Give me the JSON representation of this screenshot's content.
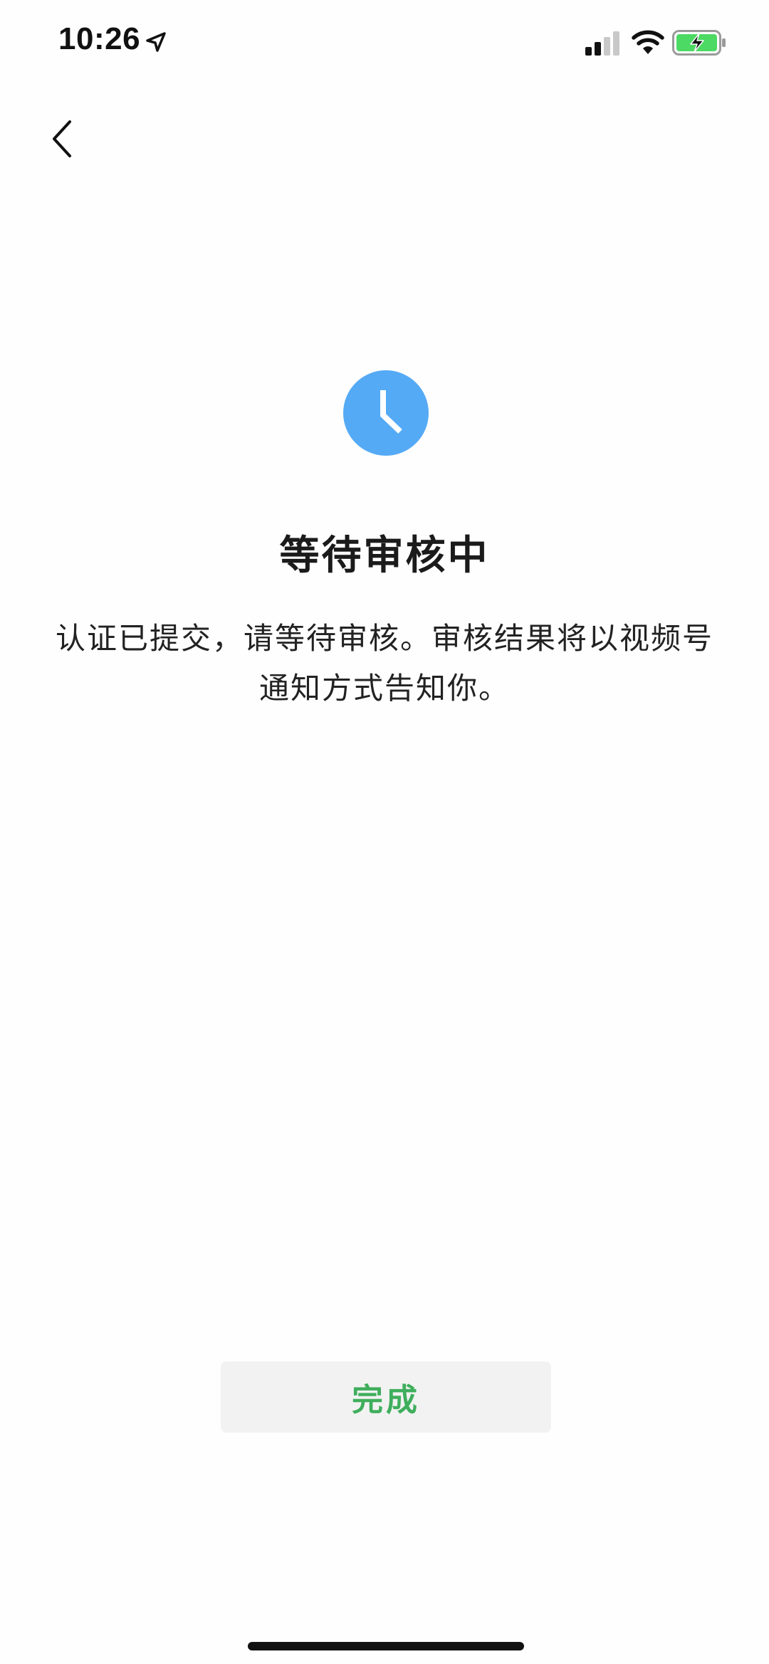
{
  "status_bar": {
    "time": "10:26",
    "location_icon": "location-arrow-icon",
    "signal_icon": "cellular-signal-icon",
    "wifi_icon": "wifi-icon",
    "battery_icon": "battery-charging-icon",
    "battery_color": "#4cd964"
  },
  "nav": {
    "back_icon": "chevron-left-icon"
  },
  "main": {
    "status_icon": "clock-icon",
    "status_icon_color": "#55aaf5",
    "title": "等待审核中",
    "description_line1": "认证已提交，请等待审核。审核结果将以视频号",
    "description_line2": "通知方式告知你。"
  },
  "footer": {
    "done_label": "完成",
    "done_color": "#3fae5c"
  }
}
